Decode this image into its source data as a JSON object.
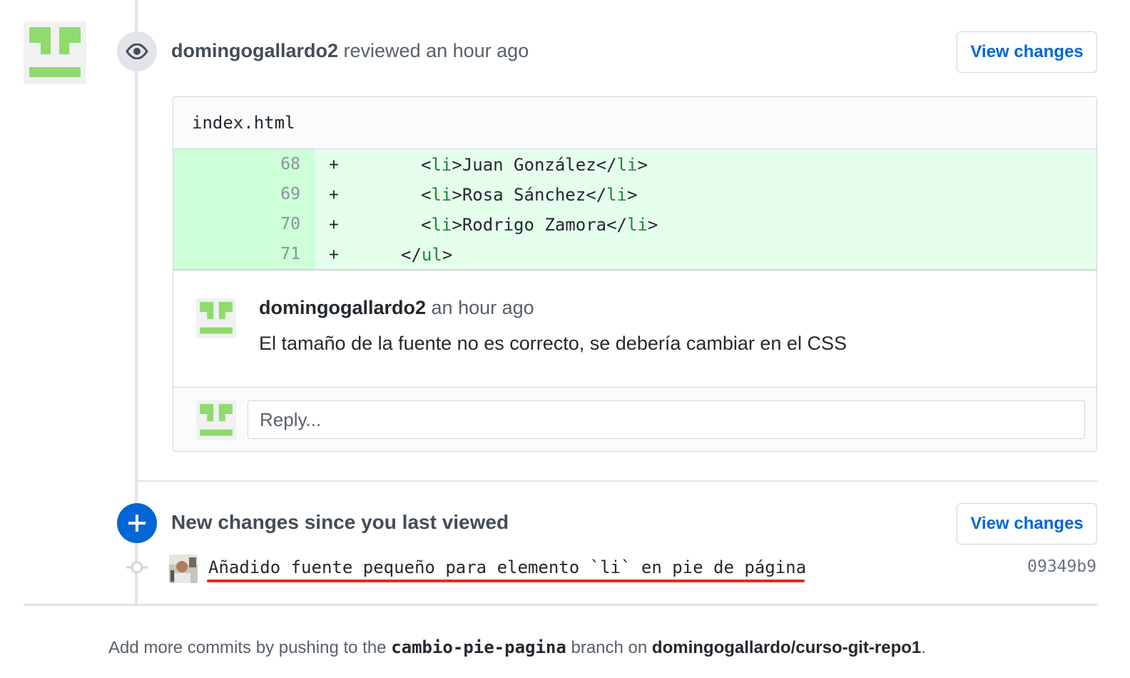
{
  "review": {
    "author": "domingogallardo2",
    "action": "reviewed an hour ago",
    "view_changes_label": "View changes",
    "file_name": "index.html",
    "diff_lines": [
      {
        "number": "68",
        "sign": "+",
        "indent": "      ",
        "open": "<",
        "tag": "li",
        "close_open": ">",
        "text": "Juan González",
        "end_open": "</",
        "end_tag": "li",
        "end_close": ">"
      },
      {
        "number": "69",
        "sign": "+",
        "indent": "      ",
        "open": "<",
        "tag": "li",
        "close_open": ">",
        "text": "Rosa Sánchez",
        "end_open": "</",
        "end_tag": "li",
        "end_close": ">"
      },
      {
        "number": "70",
        "sign": "+",
        "indent": "      ",
        "open": "<",
        "tag": "li",
        "close_open": ">",
        "text": "Rodrigo Zamora",
        "end_open": "</",
        "end_tag": "li",
        "end_close": ">"
      },
      {
        "number": "71",
        "sign": "+",
        "indent": "    ",
        "open": "</",
        "tag": "ul",
        "close_open": ">",
        "text": "",
        "end_open": "",
        "end_tag": "",
        "end_close": ""
      }
    ],
    "comment": {
      "author": "domingogallardo2",
      "time": "an hour ago",
      "body": "El tamaño de la fuente no es correcto, se debería cambiar en el CSS"
    },
    "reply_placeholder": "Reply..."
  },
  "new_changes": {
    "title": "New changes since you last viewed",
    "view_changes_label": "View changes",
    "commit_message": "Añadido fuente pequeño para elemento `li` en pie de página",
    "commit_sha": "09349b9"
  },
  "footer": {
    "prefix": "Add more commits by pushing to the ",
    "branch": "cambio-pie-pagina",
    "middle": " branch on ",
    "repo": "domingogallardo/curso-git-repo1",
    "suffix": "."
  },
  "colors": {
    "identicon": "#8fdb6e",
    "link": "#0366d6",
    "added_bg": "#e6ffed",
    "added_num_bg": "#cdffd8",
    "annotation_underline": "#e8291c"
  },
  "icons": [
    "eye-icon",
    "plus-icon",
    "git-commit-icon"
  ]
}
